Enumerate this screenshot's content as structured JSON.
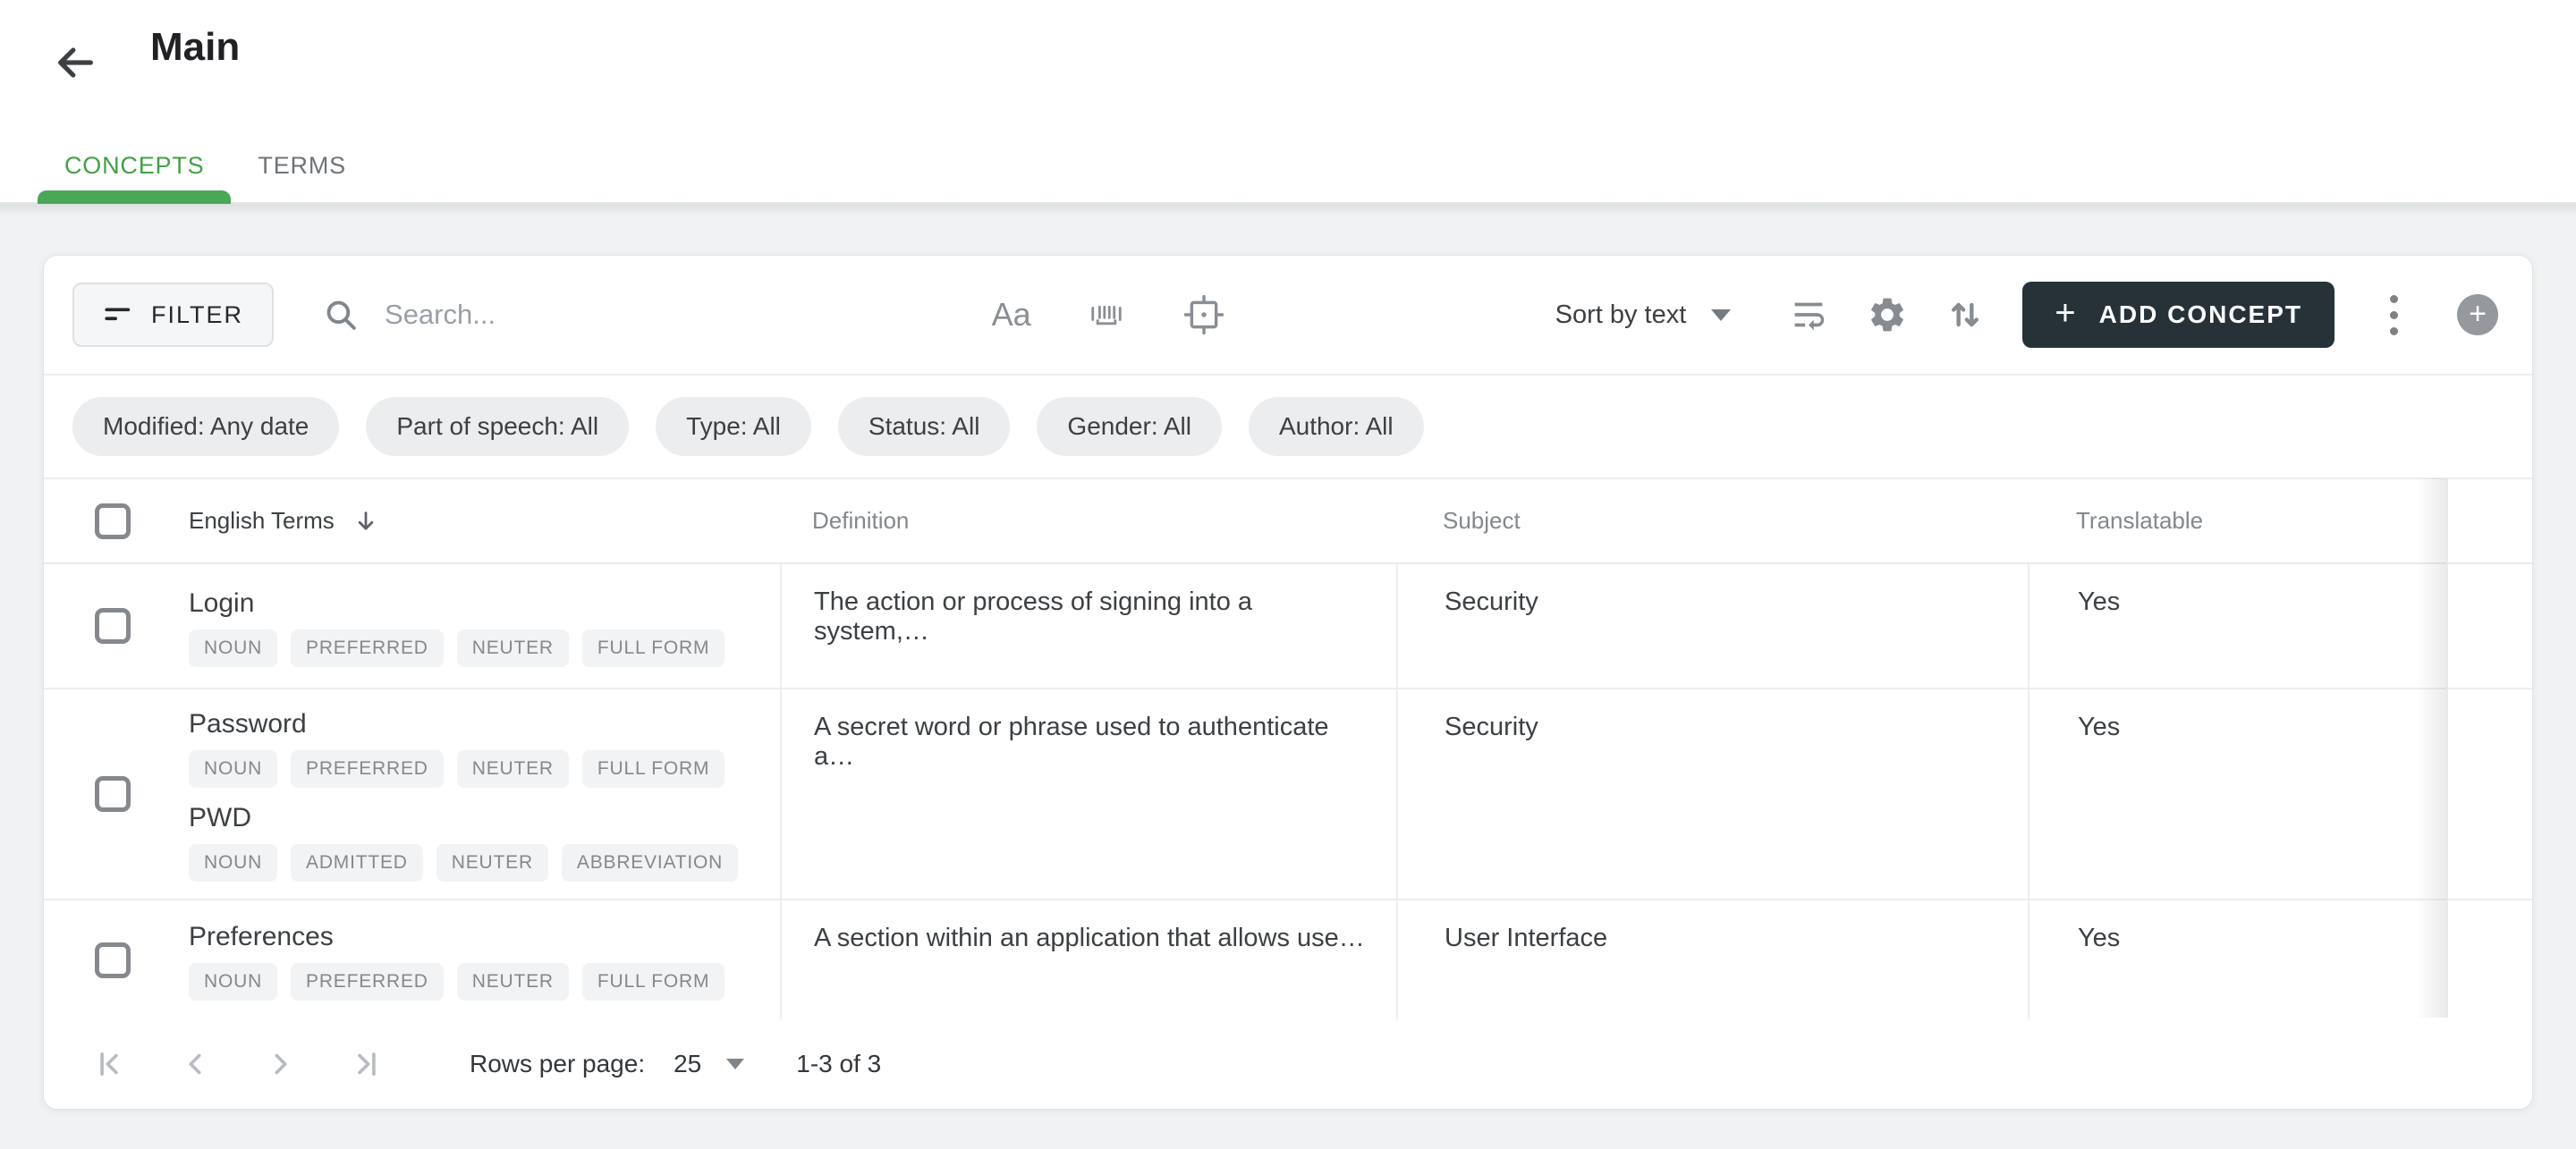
{
  "header": {
    "title": "Main"
  },
  "tabs": {
    "concepts": "CONCEPTS",
    "terms": "TERMS"
  },
  "toolbar": {
    "filter_label": "FILTER",
    "search_placeholder": "Search...",
    "match_case_label": "Aa",
    "sort_label": "Sort by text",
    "add_concept_label": "ADD CONCEPT",
    "add_concept_plus": "+",
    "circle_plus": "+"
  },
  "filters": [
    "Modified: Any date",
    "Part of speech: All",
    "Type: All",
    "Status: All",
    "Gender: All",
    "Author: All"
  ],
  "table": {
    "headers": {
      "terms": "English Terms",
      "definition": "Definition",
      "subject": "Subject",
      "translatable": "Translatable"
    },
    "rows": [
      {
        "terms": [
          {
            "name": "Login",
            "badges": [
              "NOUN",
              "PREFERRED",
              "NEUTER",
              "FULL FORM"
            ]
          }
        ],
        "definition": "The action or process of signing into a system,…",
        "subject": "Security",
        "translatable": "Yes"
      },
      {
        "terms": [
          {
            "name": "Password",
            "badges": [
              "NOUN",
              "PREFERRED",
              "NEUTER",
              "FULL FORM"
            ]
          },
          {
            "name": "PWD",
            "badges": [
              "NOUN",
              "ADMITTED",
              "NEUTER",
              "ABBREVIATION"
            ]
          }
        ],
        "definition": "A secret word or phrase used to authenticate a…",
        "subject": "Security",
        "translatable": "Yes"
      },
      {
        "terms": [
          {
            "name": "Preferences",
            "badges": [
              "NOUN",
              "PREFERRED",
              "NEUTER",
              "FULL FORM"
            ]
          }
        ],
        "definition": "A section within an application that allows use…",
        "subject": "User Interface",
        "translatable": "Yes"
      }
    ]
  },
  "footer": {
    "rows_per_page_label": "Rows per page:",
    "rows_per_page_value": "25",
    "range": "1-3 of 3"
  },
  "icons": {
    "back": "arrow-left",
    "filter": "filter-lines",
    "search": "magnifier",
    "match_case": "Aa-text",
    "whole_word": "barcode-underline",
    "exact_match": "frame-target",
    "sort_caret": "triangle-down",
    "wrap_text": "wrap-text",
    "settings": "gear",
    "sort_order": "swap-vert",
    "more": "kebab-vertical",
    "add_circle": "plus-circle",
    "column_sort": "arrow-down",
    "pagination": [
      "first-page",
      "prev-page",
      "next-page",
      "last-page"
    ]
  },
  "colors": {
    "accent_green": "#43A047",
    "tab_indicator": "#48A855",
    "add_button_bg": "#263238",
    "page_bg": "#F0F2F3",
    "chip_bg": "#EBEDEE",
    "badge_bg": "#F2F3F4",
    "icon_gray": "#8A8F94"
  }
}
